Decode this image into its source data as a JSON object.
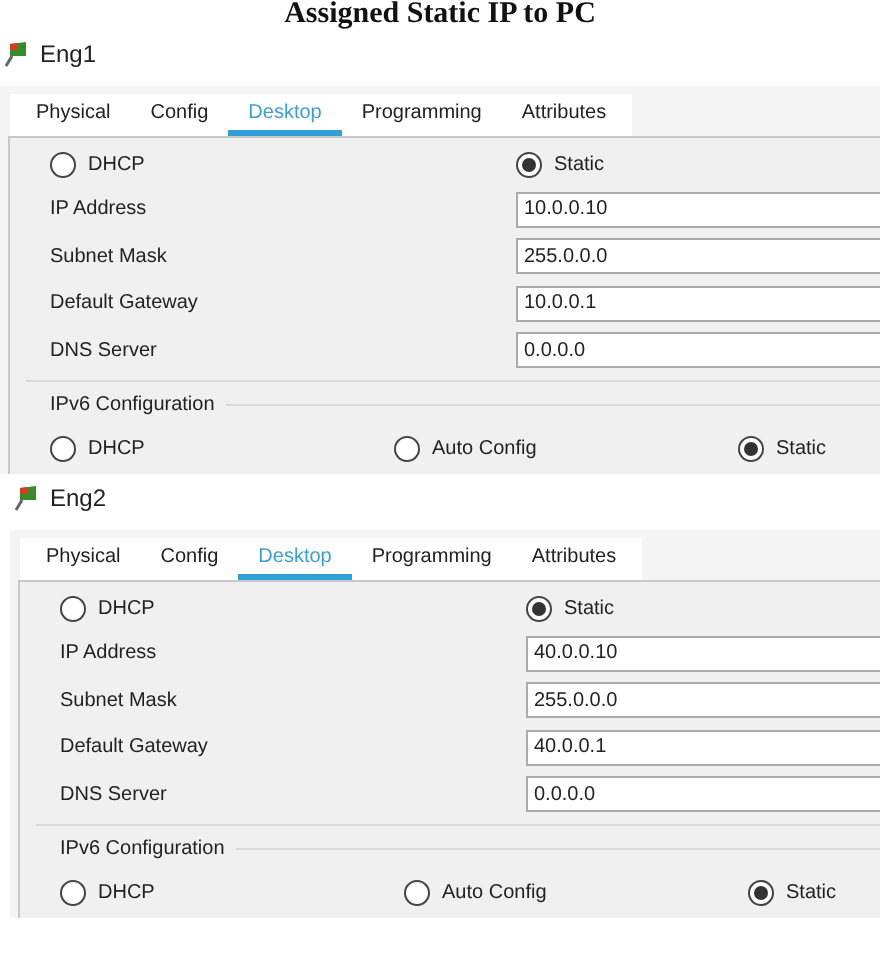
{
  "heading": "Assigned Static IP to PC",
  "windows": [
    {
      "title": "Eng1",
      "tabs": [
        {
          "label": "Physical",
          "selected": false
        },
        {
          "label": "Config",
          "selected": false
        },
        {
          "label": "Desktop",
          "selected": true
        },
        {
          "label": "Programming",
          "selected": false
        },
        {
          "label": "Attributes",
          "selected": false
        }
      ],
      "ipv4_modes": [
        {
          "label": "DHCP",
          "selected": false
        },
        {
          "label": "Static",
          "selected": true
        }
      ],
      "fields": [
        {
          "label": "IP Address",
          "value": "10.0.0.10"
        },
        {
          "label": "Subnet Mask",
          "value": "255.0.0.0"
        },
        {
          "label": "Default Gateway",
          "value": "10.0.0.1"
        },
        {
          "label": "DNS Server",
          "value": "0.0.0.0"
        }
      ],
      "ipv6_title": "IPv6 Configuration",
      "ipv6_modes": [
        {
          "label": "DHCP",
          "selected": false
        },
        {
          "label": "Auto Config",
          "selected": false
        },
        {
          "label": "Static",
          "selected": true
        }
      ]
    },
    {
      "title": "Eng2",
      "tabs": [
        {
          "label": "Physical",
          "selected": false
        },
        {
          "label": "Config",
          "selected": false
        },
        {
          "label": "Desktop",
          "selected": true
        },
        {
          "label": "Programming",
          "selected": false
        },
        {
          "label": "Attributes",
          "selected": false
        }
      ],
      "ipv4_modes": [
        {
          "label": "DHCP",
          "selected": false
        },
        {
          "label": "Static",
          "selected": true
        }
      ],
      "fields": [
        {
          "label": "IP Address",
          "value": "40.0.0.10"
        },
        {
          "label": "Subnet Mask",
          "value": "255.0.0.0"
        },
        {
          "label": "Default Gateway",
          "value": "40.0.0.1"
        },
        {
          "label": "DNS Server",
          "value": "0.0.0.0"
        }
      ],
      "ipv6_title": "IPv6 Configuration",
      "ipv6_modes": [
        {
          "label": "DHCP",
          "selected": false
        },
        {
          "label": "Auto Config",
          "selected": false
        },
        {
          "label": "Static",
          "selected": true
        }
      ]
    }
  ]
}
